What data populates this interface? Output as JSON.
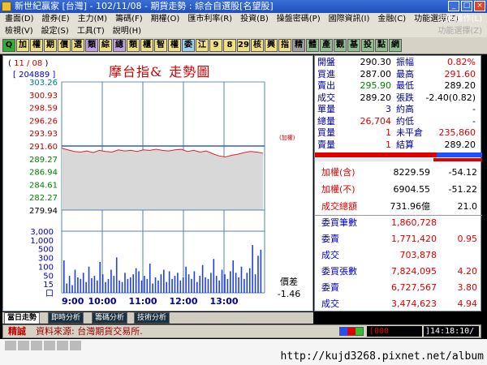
{
  "window": {
    "title": "新世紀贏家 [台灣] - 102/11/08 - 期貨走勢 : 綜合自選股[名望股]",
    "controls": [
      "_",
      "□",
      "×"
    ]
  },
  "menus": {
    "row1": [
      "畫面(D)",
      "證券(E)",
      "主力(M)",
      "籌碼(F)",
      "期權(O)",
      "匯市利率(R)",
      "投資(B)",
      "操盤密碼(P)",
      "國際資訊(I)",
      "金融(C)",
      "功能選擇(Z)"
    ],
    "row2": [
      "檢視(V)",
      "設定(S)",
      "工具(T)",
      "說明(H)"
    ],
    "right1": "功能操作(L)",
    "right2": "功能選擇(Z)"
  },
  "toolbar": [
    {
      "label": "Q",
      "color": "#30b030"
    },
    {
      "label": "加",
      "color": "#f0e080"
    },
    {
      "label": "權",
      "color": "#f0e080"
    },
    {
      "label": "期",
      "color": "#f0e080"
    },
    {
      "label": "價",
      "color": "#f0e080"
    },
    {
      "label": "選",
      "color": "#f0e080"
    },
    {
      "label": "類",
      "color": "#c0a0e0"
    },
    {
      "label": "綜",
      "color": "#f0e080"
    },
    {
      "label": "總",
      "color": "#c0a0e0"
    },
    {
      "label": "類",
      "color": "#f0e080"
    },
    {
      "label": "櫃",
      "color": "#f0e080"
    },
    {
      "label": "智",
      "color": "#f0e080"
    },
    {
      "label": "權",
      "color": "#f0e080"
    },
    {
      "label": "委",
      "color": "#a0d0f0"
    },
    {
      "label": "江",
      "color": "#f0e080"
    },
    {
      "label": "9",
      "color": "#f0e080"
    },
    {
      "label": "8",
      "color": "#f0e080"
    },
    {
      "label": "29",
      "color": "#f0e080"
    },
    {
      "label": "核",
      "color": "#f0e080"
    },
    {
      "label": "興",
      "color": "#f0e080"
    },
    {
      "label": "指",
      "color": "#f0e080"
    },
    {
      "label": "精",
      "color": "#a0a0a0"
    },
    {
      "label": "體",
      "color": "#90c090"
    },
    {
      "label": "產",
      "color": "#90c090"
    },
    {
      "label": "觀",
      "color": "#90c090"
    },
    {
      "label": "基",
      "color": "#90c090"
    },
    {
      "label": "投",
      "color": "#90c090"
    },
    {
      "label": "點",
      "color": "#90c090"
    },
    {
      "label": "網",
      "color": "#90c090"
    }
  ],
  "chart_header": {
    "date": "11 / 08",
    "code": "[ 204889 ]",
    "title": "摩台指&",
    "subtitle": "走勢圖"
  },
  "chart_data": {
    "type": "line",
    "x_ticks": [
      "9:00",
      "10:00",
      "11:00",
      "12:00",
      "13:00"
    ],
    "price_ticks": [
      "303.26",
      "300.93",
      "298.59",
      "296.26",
      "293.93",
      "291.60",
      "289.27",
      "286.94",
      "284.61",
      "282.27",
      "279.94"
    ],
    "volume_ticks": [
      "3,000",
      "1,000",
      "500",
      "300",
      "100",
      "50",
      "15",
      "口"
    ],
    "ref_price": 291.6,
    "ylim": [
      279.94,
      303.26
    ],
    "series_label": "(加權)",
    "price_series": [
      291.2,
      290.9,
      290.6,
      290.5,
      290.7,
      290.4,
      290.8,
      290.6,
      290.5,
      290.9,
      290.7,
      290.8,
      290.6,
      290.9,
      290.8,
      291.0,
      290.8,
      290.7,
      290.9,
      291.0,
      290.6,
      290.8,
      290.5,
      290.7,
      290.2,
      289.8,
      289.6,
      289.9,
      290.1,
      290.4,
      290.6,
      290.5,
      290.3
    ],
    "volume_values": [
      42,
      12,
      22,
      10,
      30,
      20,
      18,
      26,
      14,
      34,
      19,
      22,
      16,
      40,
      24,
      14,
      18,
      30,
      22,
      46,
      16,
      14,
      26,
      18,
      20,
      24,
      32,
      28,
      16,
      22,
      18,
      38,
      12,
      20,
      16,
      24,
      30,
      14,
      28,
      18,
      22,
      26,
      16,
      20,
      34,
      24,
      18,
      28,
      14,
      22,
      36,
      20,
      18,
      26,
      44,
      22,
      16,
      30,
      24,
      18,
      28,
      42,
      26,
      20,
      34,
      18,
      26,
      32,
      62,
      24,
      48,
      56
    ],
    "spread_label": "價差",
    "spread_value": "-1.46"
  },
  "quote": [
    {
      "l1": "開盤",
      "v1": "290.30",
      "c1": "num",
      "l2": "振幅",
      "v2": "0.82%",
      "c2": "red"
    },
    {
      "l1": "買進",
      "v1": "287.00",
      "c1": "num",
      "l2": "最高",
      "v2": "291.60",
      "c2": "red"
    },
    {
      "l1": "賣出",
      "v1": "295.90",
      "c1": "grn",
      "l2": "最低",
      "v2": "289.20",
      "c2": "num"
    },
    {
      "l1": "成交",
      "v1": "289.20",
      "c1": "num",
      "l2": "張跌",
      "v2": "-2.40(0.82)",
      "c2": "num"
    },
    {
      "l1": "單量",
      "v1": "3",
      "c1": "blu",
      "l2": "約高",
      "v2": "-",
      "c2": "num"
    },
    {
      "l1": "總量",
      "v1": "26,704",
      "c1": "red",
      "l2": "約低",
      "v2": "-",
      "c2": "num"
    },
    {
      "l1": "買量",
      "v1": "1",
      "c1": "red",
      "l2": "未平倉",
      "v2": "235,860",
      "c2": "red"
    },
    {
      "l1": "賣量",
      "v1": "1",
      "c1": "red",
      "l2": "結算",
      "v2": "289.20",
      "c2": "num"
    }
  ],
  "index_rows": [
    {
      "label": "加權(含)",
      "value": "8229.59",
      "change": "-54.12",
      "vcolor": "#000000"
    },
    {
      "label": "加權(不)",
      "value": "6904.55",
      "change": "-51.22",
      "vcolor": "#000000"
    },
    {
      "label": "成交總額",
      "value": "731.96億",
      "change": "21.0",
      "vcolor": "#000000"
    }
  ],
  "stats_rows": [
    {
      "label": "委買筆數",
      "value": "1,860,728",
      "extra": ""
    },
    {
      "label": "委賣",
      "value": "1,771,420",
      "extra": "0.95"
    },
    {
      "label": "成交",
      "value": "703,878",
      "extra": ""
    },
    {
      "label": "委買張數",
      "value": "7,824,095",
      "extra": "4.20"
    },
    {
      "label": "委賣",
      "value": "6,727,567",
      "extra": "3.80"
    },
    {
      "label": "成交",
      "value": "3,474,623",
      "extra": "4.94"
    }
  ],
  "tabs": [
    "當日走勢",
    "即時分析",
    "籌碼分析",
    "技術分析"
  ],
  "status": {
    "tag": "精誠",
    "source": "資料來源: 台灣期貨交易所.",
    "box": "[000",
    "time": "]14:18:10/"
  },
  "watermark": "http://kujd3268.pixnet.net/album"
}
